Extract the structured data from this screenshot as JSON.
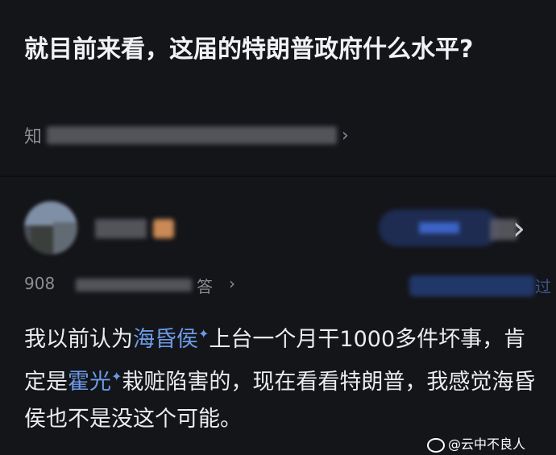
{
  "question": {
    "title": "就目前来看，这届的特朗普政府什么水平?",
    "meta_prefix": "知",
    "meta_chevron": "›"
  },
  "author": {
    "more_chevron": "›"
  },
  "stats": {
    "count_prefix": "908",
    "suffix": "答",
    "chevron": "›",
    "right_suffix": "过"
  },
  "answer": {
    "part1": "我以前认为",
    "keyword1": "海昏侯",
    "part2": "上台一个月干1000多件坏事，肯定是",
    "keyword2": "霍光",
    "part3": "栽赃陷害的，现在看看特朗普，我感觉海昏侯也不是没这个可能。",
    "sparkle": "✦"
  },
  "watermark": {
    "text": "@云中不良人"
  },
  "colors": {
    "background": "#141519",
    "keyword": "#6d9be8",
    "secondary_text": "#8c8c92"
  }
}
